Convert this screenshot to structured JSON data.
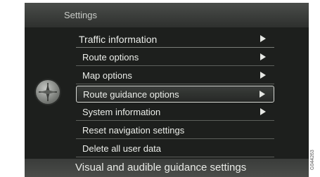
{
  "header": {
    "title": "Settings"
  },
  "menu": {
    "items": [
      {
        "label": "Traffic information",
        "arrow": true
      },
      {
        "label": "Route options",
        "arrow": true
      },
      {
        "label": "Map options",
        "arrow": true
      },
      {
        "label": "Route guidance options",
        "arrow": true,
        "selected": true
      },
      {
        "label": "System information",
        "arrow": true
      },
      {
        "label": "Reset navigation settings",
        "arrow": false
      },
      {
        "label": "Delete all user data",
        "arrow": false
      }
    ]
  },
  "footer": {
    "caption": "Visual and audible guidance settings"
  },
  "figure_code": "G044263",
  "icons": {
    "compass": "compass-icon",
    "arrow": "chevron-right-icon"
  },
  "colors": {
    "background": "#1d1f1d",
    "text": "#eceeea",
    "divider": "#5c5f5b"
  }
}
